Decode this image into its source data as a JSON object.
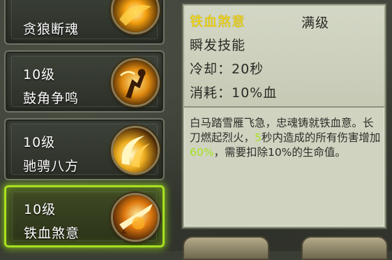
{
  "skills": [
    {
      "level": "",
      "name": "贪狼断魂",
      "selected": false
    },
    {
      "level": "10级",
      "name": "鼓角争鸣",
      "selected": false
    },
    {
      "level": "10级",
      "name": "驰骋八方",
      "selected": false
    },
    {
      "level": "10级",
      "name": "铁血煞意",
      "selected": true
    }
  ],
  "detail": {
    "title": "铁血煞意",
    "max_level": "满级",
    "type": "瞬发技能",
    "cooldown": "冷却：20秒",
    "cost": "消耗：10%血",
    "desc_1": "白马踏雪雁飞急，忠魂铸就铁血意。长刀燃起烈火，",
    "desc_sec": "5",
    "desc_2": "秒内造成的所有伤害增加",
    "desc_pct": "60%",
    "desc_3": "，需要扣除10%的生命值。"
  },
  "colors": {
    "highlight": "#a8e21f",
    "title_gold": "#f4d400",
    "selected_border": "#a7e020"
  },
  "icons": [
    "flame-swirl-icon",
    "warrior-horn-icon",
    "crescent-slash-icon",
    "blood-blade-icon"
  ]
}
